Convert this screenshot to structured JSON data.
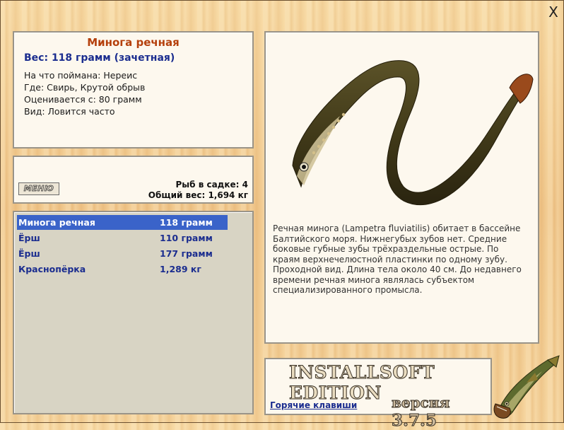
{
  "window": {
    "close_glyph": "X"
  },
  "info": {
    "fish_name": "Минога речная",
    "weight": "Вес: 118 грамм (зачетная)",
    "details": [
      "На что поймана: Нереис",
      "Где: Свирь, Крутой обрыв",
      "Оценивается с: 80 грамм",
      "Вид: Ловится часто"
    ]
  },
  "menu": {
    "button_label": "МЕНЮ",
    "cage_count": "Рыб в садке: 4",
    "total_weight": "Общий вес: 1,694 кг"
  },
  "catch_list": [
    {
      "name": "Минога речная",
      "weight": "118 грамм",
      "selected": true
    },
    {
      "name": "Ёрш",
      "weight": "110 грамм",
      "selected": false
    },
    {
      "name": "Ёрш",
      "weight": "177 грамм",
      "selected": false
    },
    {
      "name": "Краснопёрка",
      "weight": "1,289 кг",
      "selected": false
    }
  ],
  "description": "Речная минога (Lampetra fluviatilis) обитает в бассейне Балтийского моря. Нижнегубых зубов нет. Средние боковые губные зубы трёхраздельные острые. По краям верхнечелюстной пластинки по одному зубу. Проходной вид. Длина тела около 40 см. До недавнего времени речная минога являлась субъектом специализированного промысла.",
  "footer": {
    "brand": "INSTALLSOFT EDITION",
    "hotkeys": "Горячие клавиши",
    "version_label": "версия",
    "version_number": "3.7.5"
  },
  "icons": {
    "close": "close-icon",
    "fish_image": "lamprey-image",
    "logo": "pike-logo-icon"
  },
  "colors": {
    "accent_name": "#b5400c",
    "link_blue": "#1b2d8f",
    "selection": "#3a63c9"
  }
}
